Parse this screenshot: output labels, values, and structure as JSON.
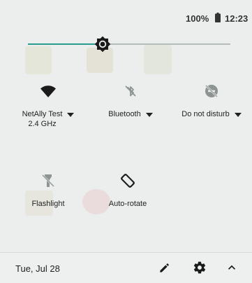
{
  "status_bar": {
    "battery_percent": "100%",
    "battery_icon": "battery-full-icon",
    "time": "12:23"
  },
  "brightness": {
    "level": 0.37,
    "icon": "brightness-icon",
    "colors": {
      "active": "#2a9d8f",
      "inactive": "#b6bcb9"
    }
  },
  "tiles": [
    {
      "label": "NetAlly Test\n2.4 GHz",
      "icon": "wifi-icon",
      "has_dropdown": true,
      "state": "on"
    },
    {
      "label": "Bluetooth",
      "icon": "bluetooth-off-icon",
      "has_dropdown": true,
      "state": "off"
    },
    {
      "label": "Do not disturb",
      "icon": "do-not-disturb-off-icon",
      "has_dropdown": true,
      "state": "off"
    },
    {
      "label": "Flashlight",
      "icon": "flashlight-off-icon",
      "has_dropdown": false,
      "state": "off"
    },
    {
      "label": "Auto-rotate",
      "icon": "auto-rotate-icon",
      "has_dropdown": false,
      "state": "on"
    }
  ],
  "footer": {
    "date": "Tue, Jul 28",
    "edit_icon": "pencil-icon",
    "settings_icon": "gear-icon",
    "collapse_icon": "chevron-up-icon"
  }
}
